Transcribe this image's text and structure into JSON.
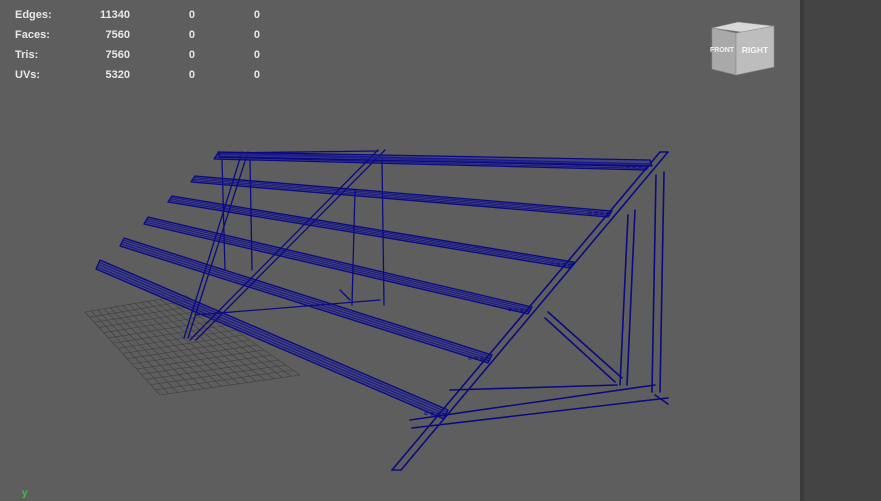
{
  "stats": [
    {
      "label": "Edges:",
      "values": [
        "11340",
        "0",
        "0"
      ]
    },
    {
      "label": "Faces:",
      "values": [
        "7560",
        "0",
        "0"
      ]
    },
    {
      "label": "Tris:",
      "values": [
        "7560",
        "0",
        "0"
      ]
    },
    {
      "label": "UVs:",
      "values": [
        "5320",
        "0",
        "0"
      ]
    }
  ],
  "view_cube": {
    "front": "FRONT",
    "right": "RIGHT"
  },
  "axis": {
    "label": "y"
  },
  "colors": {
    "viewport_bg": "#5e5e5e",
    "wireframe": "#0b0b80",
    "grid": "#3e3e3e",
    "axis_y": "#37c837",
    "side_panel": "#444444"
  }
}
